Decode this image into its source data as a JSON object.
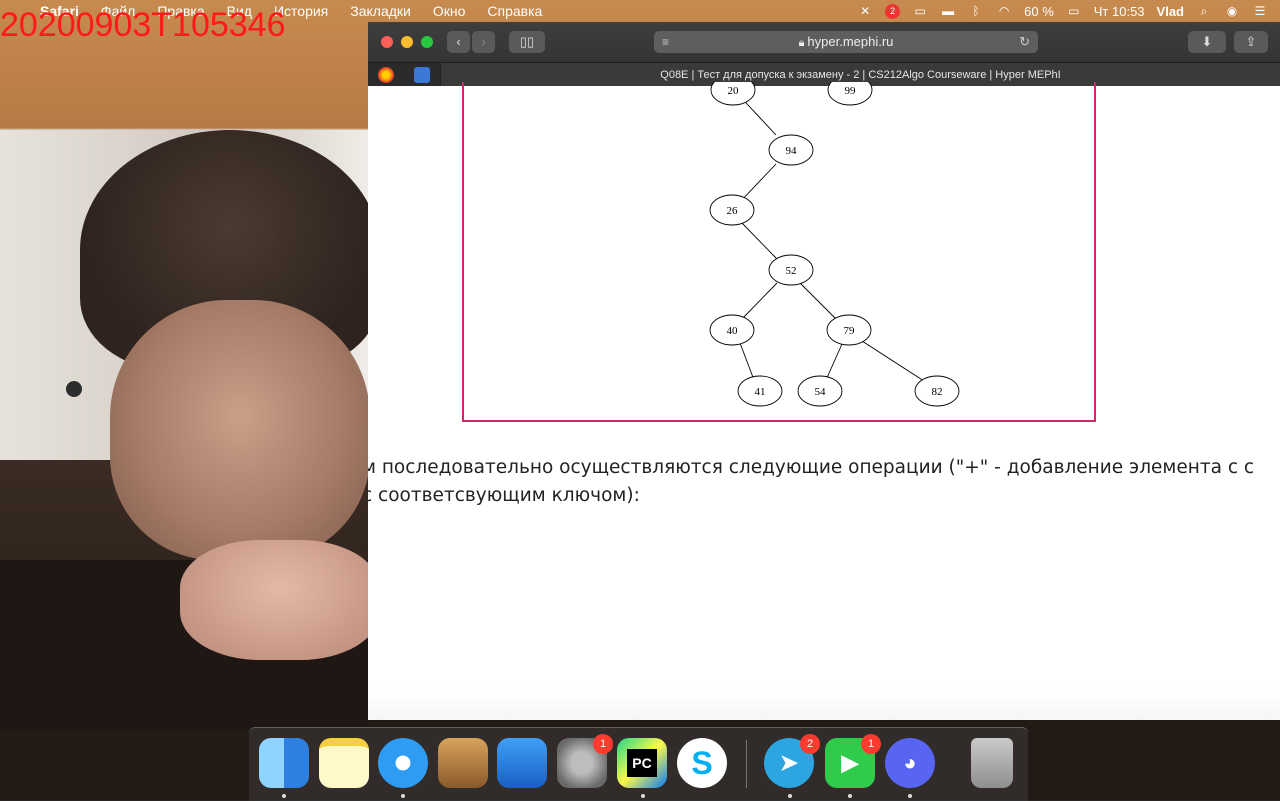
{
  "overlay": {
    "timestamp": "20200903T105346"
  },
  "menubar": {
    "apple_glyph": "",
    "items": [
      "Safari",
      "Файл",
      "Правка",
      "Вид",
      "История",
      "Закладки",
      "Окно",
      "Справка"
    ],
    "battery": "60 %",
    "clock": "Чт 10:53",
    "user": "Vlad",
    "notification_badge": "2"
  },
  "browser": {
    "url": "hyper.mephi.ru",
    "tab_title": "Q08E | Тест для допуска к экзамену - 2 | CS212Algo Courseware | Hyper MEPhI"
  },
  "figure": {
    "nodes": [
      "20",
      "99",
      "94",
      "26",
      "52",
      "40",
      "79",
      "41",
      "54",
      "82"
    ]
  },
  "question": {
    "line1": "м последовательно осуществляются следующие операции (\"+\" - добавление элемента с с",
    "line2": "с соответсвующим ключом):"
  },
  "dock": {
    "items": [
      {
        "name": "Finder",
        "badge": ""
      },
      {
        "name": "Notes",
        "badge": ""
      },
      {
        "name": "Safari",
        "badge": ""
      },
      {
        "name": "GarageBand",
        "badge": ""
      },
      {
        "name": "Xcode",
        "badge": ""
      },
      {
        "name": "System Preferences",
        "badge": "1"
      },
      {
        "name": "PyCharm",
        "badge": ""
      },
      {
        "name": "Skype",
        "badge": ""
      },
      {
        "name": "Telegram",
        "badge": "2"
      },
      {
        "name": "FaceTime",
        "badge": "1"
      },
      {
        "name": "Discord",
        "badge": ""
      },
      {
        "name": "Trash",
        "badge": ""
      }
    ],
    "pycharm_label": "PC"
  }
}
